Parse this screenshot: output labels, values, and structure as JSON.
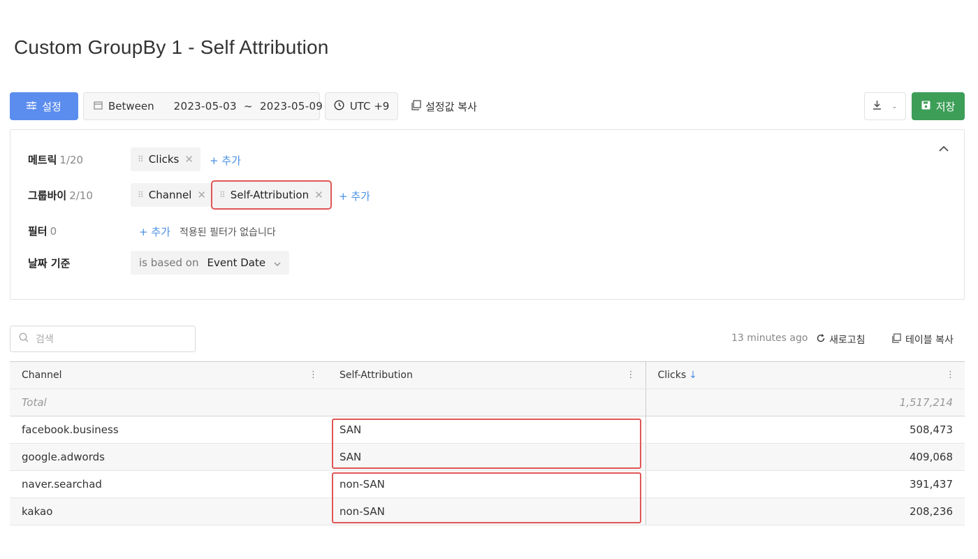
{
  "page": {
    "title": "Custom GroupBy 1 - Self Attribution"
  },
  "toolbar": {
    "settings_label": "설정",
    "date_mode": "Between",
    "date_range": "2023-05-03  ~  2023-05-09",
    "timezone": "UTC +9",
    "copy_settings_label": "설정값 복사",
    "save_label": "저장"
  },
  "panel": {
    "metric": {
      "label": "메트릭",
      "count": "1/20",
      "chips": [
        "Clicks"
      ],
      "add": "+ 추가"
    },
    "groupby": {
      "label": "그룹바이",
      "count": "2/10",
      "chips": [
        "Channel",
        "Self-Attribution"
      ],
      "add": "+ 추가"
    },
    "filter": {
      "label": "필터",
      "count": "0",
      "add": "+ 추가",
      "empty_note": "적용된 필터가 없습니다"
    },
    "date_basis": {
      "label": "날짜 기준",
      "prefix": "is based on",
      "value": "Event Date"
    }
  },
  "search": {
    "placeholder": "검색"
  },
  "table_meta": {
    "updated": "13 minutes ago",
    "refresh_label": "새로고침",
    "copy_label": "테이블 복사"
  },
  "table": {
    "columns": [
      "Channel",
      "Self-Attribution",
      "Clicks"
    ],
    "total": {
      "label": "Total",
      "clicks": "1,517,214"
    },
    "rows": [
      {
        "channel": "facebook.business",
        "attribution": "SAN",
        "clicks": "508,473"
      },
      {
        "channel": "google.adwords",
        "attribution": "SAN",
        "clicks": "409,068"
      },
      {
        "channel": "naver.searchad",
        "attribution": "non-SAN",
        "clicks": "391,437"
      },
      {
        "channel": "kakao",
        "attribution": "non-SAN",
        "clicks": "208,236"
      }
    ]
  },
  "colors": {
    "primary": "#5b8def",
    "save": "#3d9e58",
    "highlight": "#e05656",
    "link": "#4a90e2"
  }
}
